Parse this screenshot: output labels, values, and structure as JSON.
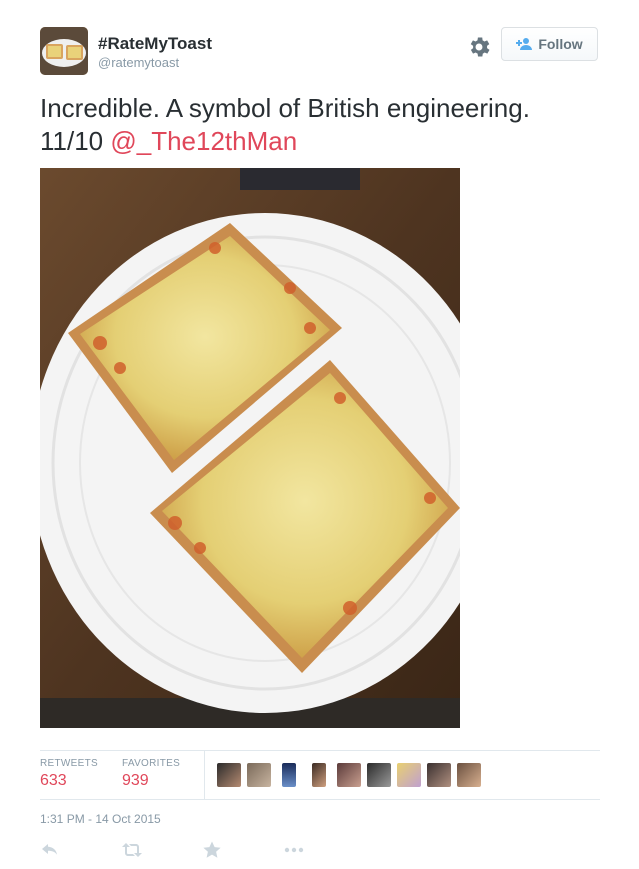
{
  "user": {
    "display_name": "#RateMyToast",
    "handle": "@ratemytoast",
    "avatar_icon": "toast-avatar"
  },
  "header": {
    "gear_icon": "gear-icon",
    "follow_label": "Follow",
    "follow_icon": "add-user-icon"
  },
  "tweet": {
    "text": "Incredible. A symbol of British engineering. 11/10 ",
    "mention": "@_The12thMan",
    "photo": "photo of two slices of toast with baked beans and melted cheese on a white plate"
  },
  "stats": {
    "retweets_label": "RETWEETS",
    "retweets_count": "633",
    "favorites_label": "FAVORITES",
    "favorites_count": "939",
    "favoriter_avatars": 10
  },
  "timestamp": "1:31 PM - 14 Oct 2015",
  "actions": [
    "reply-icon",
    "retweet-icon",
    "favorite-icon",
    "more-icon"
  ],
  "colors": {
    "link": "#e0475a",
    "muted": "#8899a6",
    "text": "#292f33",
    "border": "#e1e8ed"
  }
}
